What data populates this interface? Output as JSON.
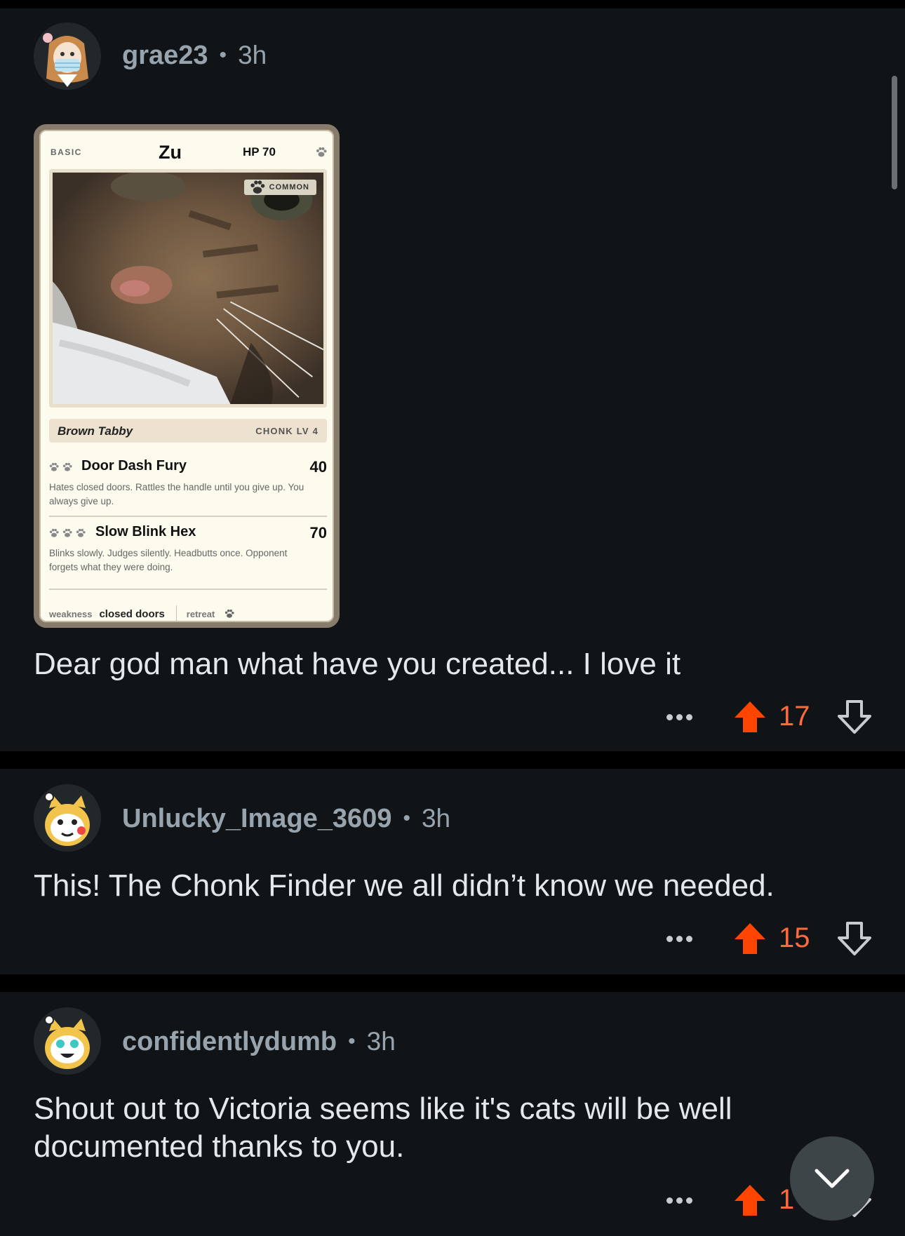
{
  "colors": {
    "background": "#000000",
    "card_bg": "#111417",
    "meta_text": "#97a3ad",
    "body_text": "#e4e8ea",
    "upvote_active": "#ff4500",
    "score_active": "#ff6a3d"
  },
  "comments": [
    {
      "username": "grae23",
      "separator": "•",
      "time": "3h",
      "text": "Dear god man what have you created... I love it",
      "score": "17",
      "upvoted": true,
      "attachment": {
        "stage": "BASIC",
        "name": "Zu",
        "hp": "HP 70",
        "rarity": "COMMON",
        "breed": "Brown Tabby",
        "level": "CHONK LV 4",
        "moves": [
          {
            "cost": 2,
            "name": "Door Dash Fury",
            "damage": "40",
            "description": "Hates closed doors. Rattles the handle until you give up. You always give up."
          },
          {
            "cost": 3,
            "name": "Slow Blink Hex",
            "damage": "70",
            "description": "Blinks slowly. Judges silently. Headbutts once. Opponent forgets what they were doing."
          }
        ],
        "weakness_label": "weakness",
        "weakness_value": "closed doors",
        "retreat_label": "retreat",
        "retreat_cost": 1
      }
    },
    {
      "username": "Unlucky_Image_3609",
      "separator": "•",
      "time": "3h",
      "text": "This! The Chonk Finder we all didn’t know we needed.",
      "score": "15",
      "upvoted": true
    },
    {
      "username": "confidentlydumb",
      "separator": "•",
      "time": "3h",
      "text": "Shout out to Victoria seems like it's cats will be well documented thanks to you.",
      "score": "1",
      "upvoted": true
    }
  ],
  "icons": {
    "more": "ellipsis-icon",
    "upvote": "upvote-arrow-icon",
    "downvote": "downvote-arrow-icon",
    "paw": "paw-icon",
    "collapse": "chevron-down-icon"
  }
}
